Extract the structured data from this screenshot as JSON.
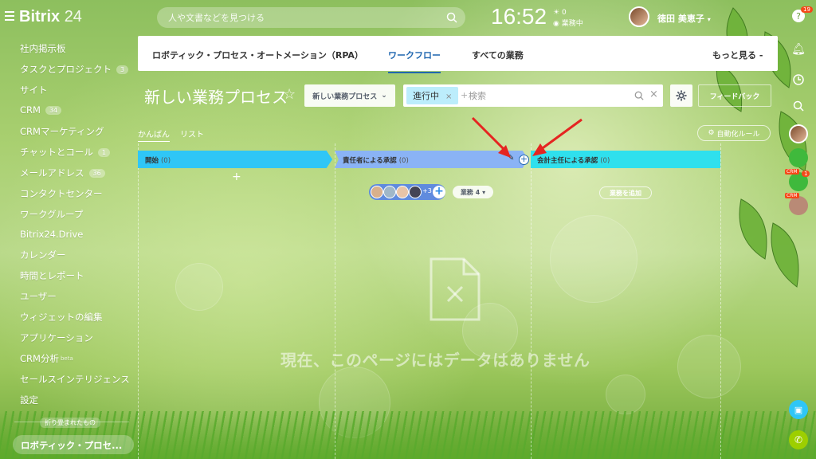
{
  "header": {
    "logo_name": "Bitrix",
    "logo_number": "24",
    "search_placeholder": "人や文書などを見つける",
    "clock": "16:52",
    "work_status": "業務中",
    "work_indicator": "0",
    "user_name": "徳田 美恵子",
    "help_badge": "19"
  },
  "sidebar": {
    "items": [
      {
        "label": "社内掲示板",
        "count": ""
      },
      {
        "label": "タスクとプロジェクト",
        "count": "3"
      },
      {
        "label": "サイト",
        "count": ""
      },
      {
        "label": "CRM",
        "count": "34"
      },
      {
        "label": "CRMマーケティング",
        "count": ""
      },
      {
        "label": "チャットとコール",
        "count": "1"
      },
      {
        "label": "メールアドレス",
        "count": "36"
      },
      {
        "label": "コンタクトセンター",
        "count": ""
      },
      {
        "label": "ワークグループ",
        "count": ""
      },
      {
        "label": "Bitrix24.Drive",
        "count": ""
      },
      {
        "label": "カレンダー",
        "count": ""
      },
      {
        "label": "時間とレポート",
        "count": ""
      },
      {
        "label": "ユーザー",
        "count": ""
      },
      {
        "label": "ウィジェットの編集",
        "count": ""
      },
      {
        "label": "アプリケーション",
        "count": ""
      },
      {
        "label": "CRM分析",
        "count": "",
        "suffix": "beta"
      },
      {
        "label": "セールスインテリジェンス",
        "count": ""
      },
      {
        "label": "設定",
        "count": ""
      }
    ],
    "collapsed_label": "折り畳まれたもの",
    "active_item": "ロボティック・プロセ..."
  },
  "nav": {
    "tabs": [
      {
        "label": "ロボティック・プロセス・オートメーション（RPA）"
      },
      {
        "label": "ワークフロー"
      },
      {
        "label": "すべての業務"
      }
    ],
    "more": "もっと見る -"
  },
  "page": {
    "title": "新しい業務プロセス",
    "new_process_btn": "新しい業務プロセス",
    "filter_chip": "進行中",
    "filter_placeholder": "検索",
    "feedback": "フィードバック",
    "view_kanban": "かんばん",
    "view_list": "リスト",
    "automation_rules": "自動化ルール"
  },
  "kanban": {
    "columns": [
      {
        "title": "開始",
        "count": "(0)",
        "color": "#2fc6f6"
      },
      {
        "title": "責任者による承認",
        "count": "(0)",
        "color": "#8ab3f5"
      },
      {
        "title": "会計主任による承認",
        "count": "(0)",
        "color": "#2fe0ed"
      }
    ],
    "participants_more": "+3",
    "tasks_btn": "業務 4",
    "add_task": "業務を追加",
    "empty_text": "現在、このページにはデータはありません"
  },
  "rightbar": {
    "crm_badge": "1",
    "crm_label": "CRM"
  }
}
